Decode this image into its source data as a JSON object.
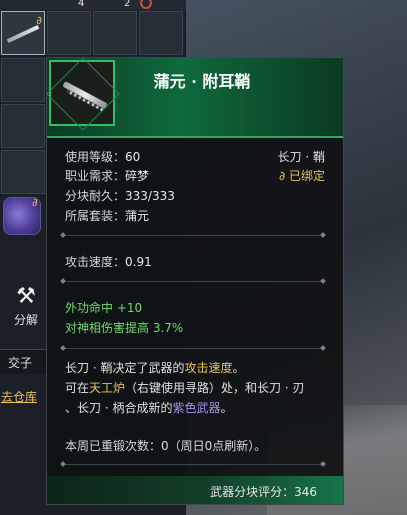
{
  "inventory": {
    "top_counts": [
      "4",
      "2"
    ],
    "tool_label": "分解",
    "strip_text": "交子",
    "warehouse_link": "去仓库"
  },
  "tooltip": {
    "title": "蒲元 · 附耳鞘",
    "weapon_type": "长刀 · 鞘",
    "bound_label": "已绑定",
    "bound_icon": "chain-link-icon",
    "stats": [
      {
        "label": "使用等级",
        "value": "60"
      },
      {
        "label": "职业需求",
        "value": "碎梦"
      },
      {
        "label": "分块耐久",
        "value": "333/333"
      },
      {
        "label": "所属套装",
        "value": "蒲元"
      }
    ],
    "attack_speed_label": "攻击速度",
    "attack_speed_value": "0.91",
    "bonus1_label": "外功命中",
    "bonus1_value": "+10",
    "bonus2_label": "对神相伤害提高",
    "bonus2_value": "3.7%",
    "desc_line1_a": "长刀 · 鞘决定了武器的",
    "desc_line1_hl": "攻击速度",
    "desc_line1_b": "。",
    "desc_line2_a": "可在",
    "desc_line2_hl": "天工炉",
    "desc_line2_b": "（右键使用寻路）处，和长刀 · 刃",
    "desc_line3_a": "、长刀 · 柄合成新的",
    "desc_line3_hl": "紫色武器",
    "desc_line3_b": "。",
    "reforge_text": "本周已重锻次数：0（周日0点刷新）。",
    "score_label": "武器分块评分：",
    "score_value": "346"
  },
  "colors": {
    "highlight_gold": "#e8c25a",
    "bonus_green": "#6fdc6f",
    "purple_weapon": "#a98cf0",
    "header_green": "#0f6a3c"
  }
}
